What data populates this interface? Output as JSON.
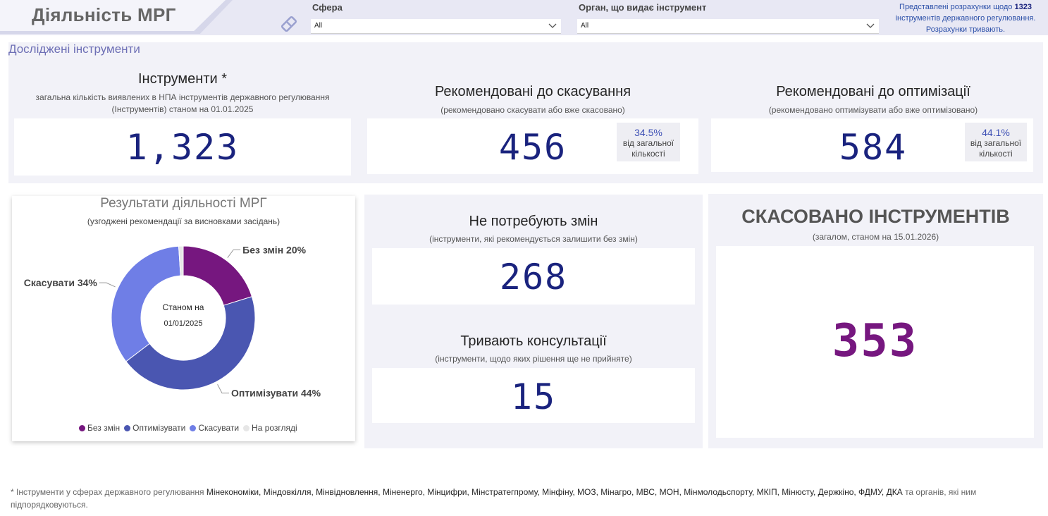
{
  "header": {
    "title": "Діяльність МРГ",
    "filters": [
      {
        "label": "Сфера",
        "value": "All"
      },
      {
        "label": "Орган, що видає інструмент",
        "value": "All"
      }
    ],
    "note_prefix": "Представлені розрахунки щодо",
    "note_count": "1323",
    "note_suffix": "інструментів державного регулювання.",
    "note_line3": "Розрахунки тривають."
  },
  "section_title": "Досліджені інструменти",
  "kpis": {
    "total": {
      "title": "Інструменти *",
      "subtitle": "загальна кількість виявлених в НПА інструментів державного регулювання (Інструментів) станом на 01.01.2025",
      "value": "1,323"
    },
    "cancel": {
      "title": "Рекомендовані до скасування",
      "subtitle": "(рекомендовано скасувати або вже скасовано)",
      "value": "456",
      "pct": "34.5%",
      "pct_label": "від загальної кількості"
    },
    "optimize": {
      "title": "Рекомендовані до оптимізації",
      "subtitle": "(рекомендовано оптимізувати або вже оптимізовано)",
      "value": "584",
      "pct": "44.1%",
      "pct_label": "від загальної кількості"
    },
    "no_change": {
      "title": "Не потребують змін",
      "subtitle": "(інструменти, які рекомендується залишити без змін)",
      "value": "268"
    },
    "consult": {
      "title": "Тривають консультації",
      "subtitle": "(інструменти, щодо яких рішення ще не прийняте)",
      "value": "15"
    },
    "cancelled": {
      "title": "СКАСОВАНО ІНСТРУМЕНТІВ",
      "subtitle": "(загалом, станом на 15.01.2026)",
      "value": "353"
    }
  },
  "donut": {
    "title": "Результати діяльності МРГ",
    "subtitle": "(узгоджені рекомендації за висновками засідань)",
    "center_line1": "Станом на",
    "center_line2": "01/01/2025"
  },
  "chart_data": {
    "type": "pie",
    "title": "Результати діяльності МРГ",
    "subtitle": "(узгоджені рекомендації за висновками засідань)",
    "series": [
      {
        "name": "Без змін",
        "value": 20,
        "label": "Без змін 20%",
        "color": "#76177f"
      },
      {
        "name": "Оптимізувати",
        "value": 44,
        "label": "Оптимізувати 44%",
        "color": "#4a56b1"
      },
      {
        "name": "Скасувати",
        "value": 34,
        "label": "Скасувати 34%",
        "color": "#6f7ee6"
      },
      {
        "name": "На розгляді",
        "value": 1,
        "label": "",
        "color": "#e6e6e6"
      }
    ],
    "legend": "bottom"
  },
  "footnote": {
    "prefix": "* Інструменти у сферах державного регулювання",
    "list": "Мінекономіки, Міндовкілля, Мінвідновлення, Міненерго, Мінцифри, Мінстратегпрому, Мінфіну, МОЗ, Мінагро, МВС, МОН, Мінмолодьспорту, МКІП, Мінюсту, Держкіно, ФДМУ, ДКА",
    "suffix": "та органів, які ним підпорядковуються."
  }
}
